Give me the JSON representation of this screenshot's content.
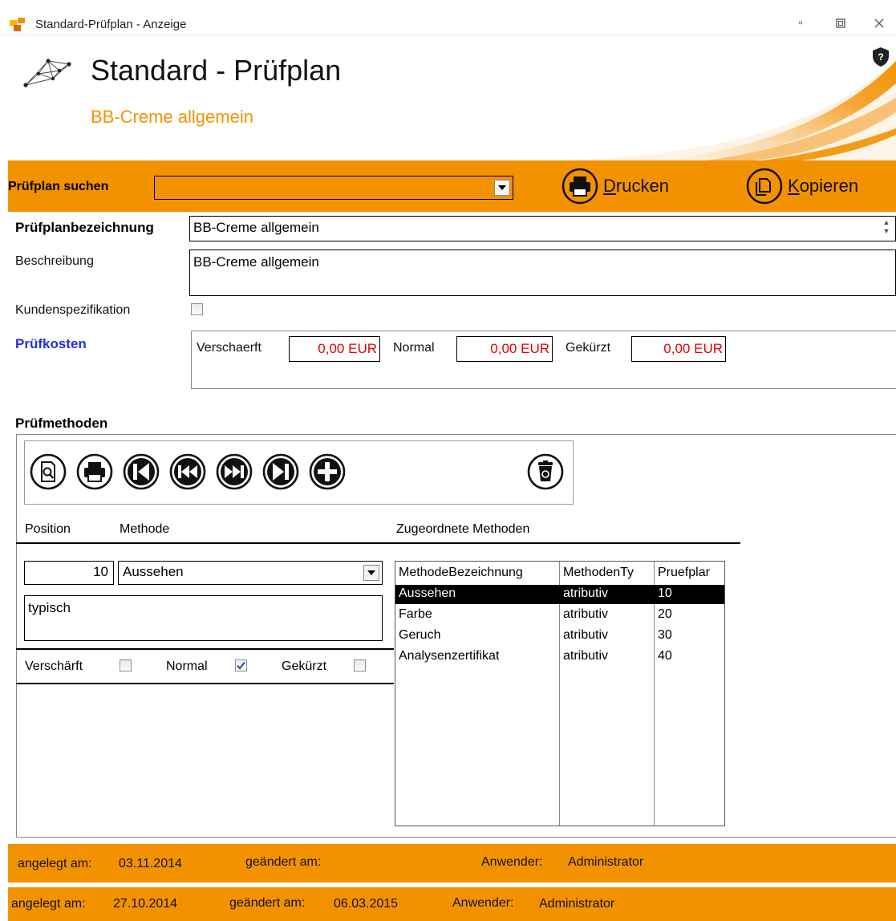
{
  "window": {
    "title": "Standard-Prüfplan - Anzeige",
    "controls": [
      "minimize-icon",
      "maximize-icon",
      "close-icon"
    ]
  },
  "header": {
    "title": "Standard - Prüfplan",
    "subtitle": "BB-Creme allgemein"
  },
  "search": {
    "label": "Prüfplan suchen",
    "value": ""
  },
  "actions": {
    "print_label": "Drucken",
    "print_hotkey": "D",
    "print_rest": "rucken",
    "copy_label": "Kopieren",
    "copy_hotkey": "K",
    "copy_rest": "opieren"
  },
  "form": {
    "plan_name_label": "Prüfplanbezeichnung",
    "plan_name_value": "BB-Creme allgemein",
    "description_label": "Beschreibung",
    "description_value": "BB-Creme allgemein",
    "customer_spec_label": "Kundenspezifikation",
    "customer_spec_checked": false,
    "costs_label": "Prüfkosten",
    "costs": {
      "verschaerft_label": "Verschaerft",
      "verschaerft_value": "0,00 EUR",
      "normal_label": "Normal",
      "normal_value": "0,00 EUR",
      "gekuerzt_label": "Gekürzt",
      "gekuerzt_value": "0,00 EUR"
    }
  },
  "methods": {
    "heading": "Prüfmethoden",
    "toolbar_icons": [
      "search-document-icon",
      "print-icon",
      "first-record-icon",
      "previous-record-icon",
      "next-record-icon",
      "last-record-icon",
      "add-icon",
      "delete-icon"
    ],
    "headers": {
      "position": "Position",
      "method": "Methode",
      "assigned": "Zugeordnete Methoden"
    },
    "position_value": "10",
    "method_value": "Aussehen",
    "typical_value": "typisch",
    "flags": {
      "verschaerft_label": "Verschärft",
      "verschaerft_checked": false,
      "normal_label": "Normal",
      "normal_checked": true,
      "gekuerzt_label": "Gekürzt",
      "gekuerzt_checked": false
    },
    "grid": {
      "columns": [
        "MethodeBezeichnung",
        "MethodenTy",
        "Pruefplar"
      ],
      "rows": [
        {
          "name": "Aussehen",
          "type": "atributiv",
          "plan": "10",
          "selected": true
        },
        {
          "name": "Farbe",
          "type": "atributiv",
          "plan": "20",
          "selected": false
        },
        {
          "name": "Geruch",
          "type": "atributiv",
          "plan": "30",
          "selected": false
        },
        {
          "name": "Analysenzertifikat",
          "type": "atributiv",
          "plan": "40",
          "selected": false
        }
      ]
    }
  },
  "footer_inner": {
    "created_label": "angelegt am:",
    "created_value": "03.11.2014",
    "changed_label": "geändert am:",
    "changed_value": "",
    "user_label": "Anwender:",
    "user_value": "Administrator"
  },
  "footer_outer": {
    "created_label": "angelegt am:",
    "created_value": "27.10.2014",
    "changed_label": "geändert am:",
    "changed_value": "06.03.2015",
    "user_label": "Anwender:",
    "user_value": "Administrator"
  },
  "colors": {
    "accent": "#f39200",
    "link_blue": "#1b33d6",
    "cost_red": "#e00000"
  }
}
